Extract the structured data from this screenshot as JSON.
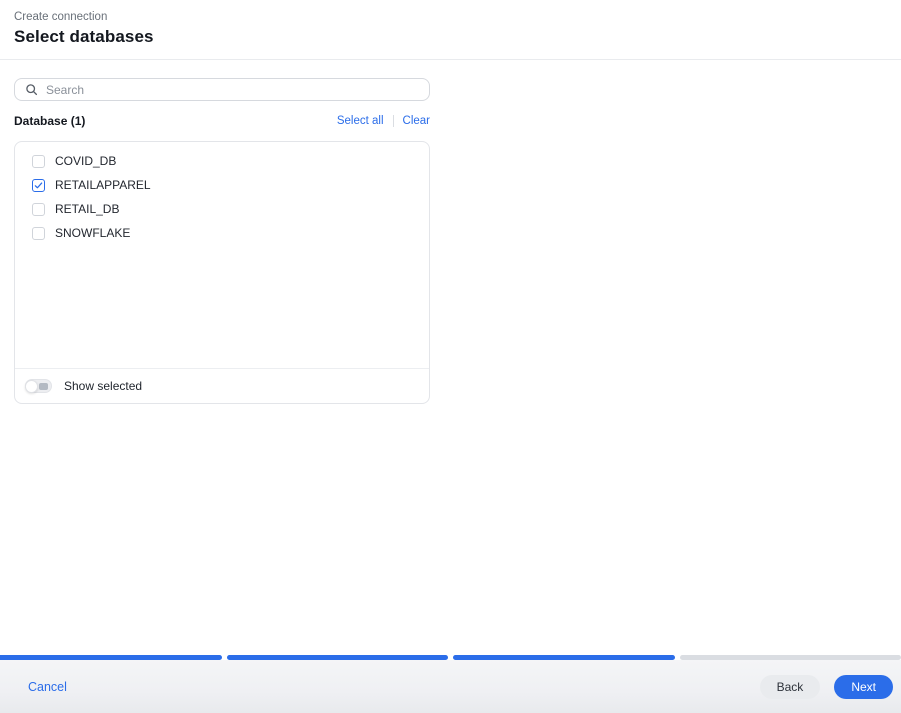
{
  "header": {
    "breadcrumb": "Create connection",
    "title": "Select databases"
  },
  "search": {
    "placeholder": "Search",
    "icon": "search-icon"
  },
  "list_header": {
    "label": "Database (1)",
    "select_all_label": "Select all",
    "clear_label": "Clear"
  },
  "panel": {
    "databases": [
      {
        "name": "COVID_DB",
        "checked": false
      },
      {
        "name": "RETAILAPPAREL",
        "checked": true
      },
      {
        "name": "RETAIL_DB",
        "checked": false
      },
      {
        "name": "SNOWFLAKE",
        "checked": false
      }
    ],
    "show_selected_label": "Show selected",
    "show_selected_on": false
  },
  "progress": {
    "steps_total": 4,
    "steps_completed": 3,
    "completed_color": "#2b6de9",
    "remaining_color": "#dadde2"
  },
  "footer": {
    "cancel_label": "Cancel",
    "back_label": "Back",
    "next_label": "Next"
  },
  "colors": {
    "accent_blue": "#2b6de9"
  }
}
